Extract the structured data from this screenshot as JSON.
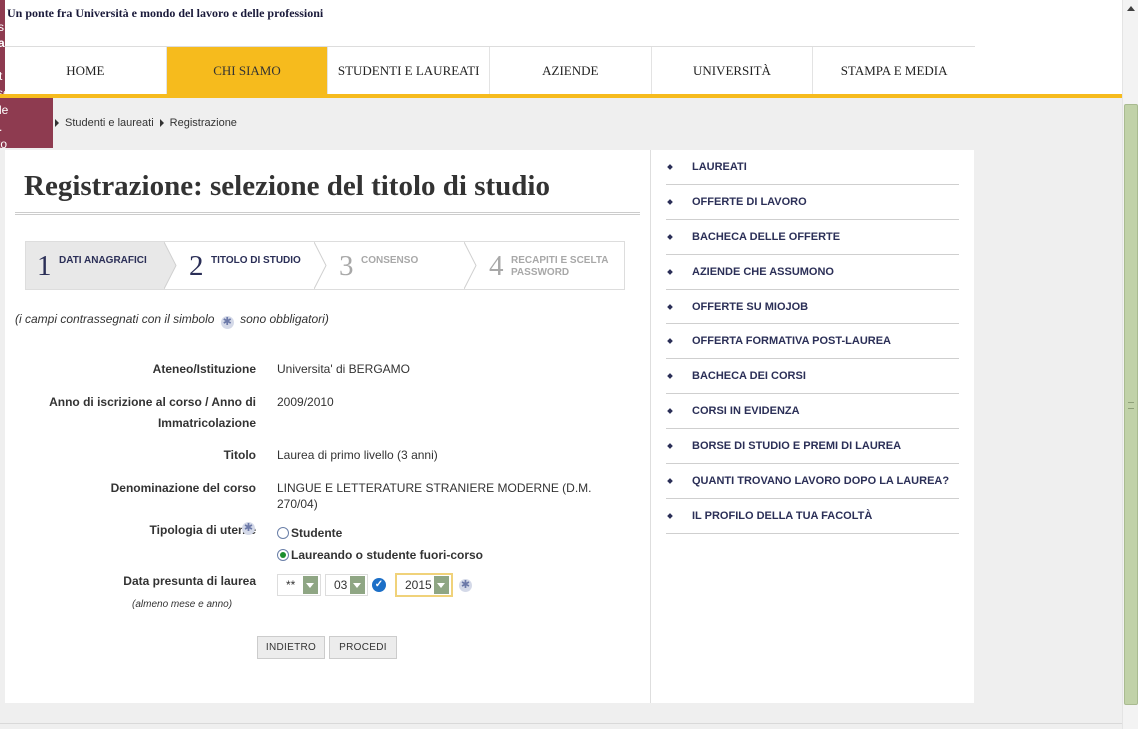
{
  "header": {
    "tagline": "Un ponte fra Università e mondo del lavoro e delle professioni",
    "side_fragments": [
      "s",
      "a",
      "t",
      "sere",
      "le",
      ".",
      "to"
    ]
  },
  "nav": {
    "items": [
      {
        "label": "HOME",
        "active": false
      },
      {
        "label": "CHI SIAMO",
        "active": true
      },
      {
        "label": "STUDENTI E LAUREATI",
        "active": false
      },
      {
        "label": "AZIENDE",
        "active": false
      },
      {
        "label": "UNIVERSITÀ",
        "active": false
      },
      {
        "label": "STAMPA E MEDIA",
        "active": false
      }
    ],
    "accent_color": "#f6bb1d"
  },
  "breadcrumb": [
    "Studenti e laureati",
    "Registrazione"
  ],
  "main": {
    "title": "Registrazione: selezione del titolo di studio",
    "steps": [
      {
        "number": "1",
        "label": "DATI ANAGRAFICI",
        "state": "done"
      },
      {
        "number": "2",
        "label": "TITOLO DI STUDIO",
        "state": "current"
      },
      {
        "number": "3",
        "label": "CONSENSO",
        "state": "todo"
      },
      {
        "number": "4",
        "label": "RECAPITI E SCELTA PASSWORD",
        "state": "todo"
      }
    ],
    "required_note_prefix": "(i campi contrassegnati con il simbolo",
    "required_note_suffix": "sono obbligatori)",
    "form": {
      "ateneo_label": "Ateneo/Istituzione",
      "ateneo_value": "Universita' di BERGAMO",
      "anno_label": "Anno di iscrizione al corso / Anno di Immatricolazione",
      "anno_value": "2009/2010",
      "titolo_label": "Titolo",
      "titolo_value": "Laurea di primo livello (3 anni)",
      "denominazione_label": "Denominazione del corso",
      "denominazione_value": "LINGUE E LETTERATURE STRANIERE MODERNE (D.M. 270/04)",
      "tipologia_label": "Tipologia di utente",
      "tipologia_options": [
        {
          "label": "Studente",
          "checked": false
        },
        {
          "label": "Laureando o studente fuori-corso",
          "checked": true
        }
      ],
      "data_label": "Data presunta di laurea",
      "data_sublabel": "(almeno mese e anno)",
      "day_value": "**",
      "month_value": "03",
      "year_value": "2015"
    },
    "buttons": {
      "back": "INDIETRO",
      "next": "PROCEDI"
    }
  },
  "sidebar": {
    "items": [
      "LAUREATI",
      "OFFERTE DI LAVORO",
      "BACHECA DELLE OFFERTE",
      "AZIENDE CHE ASSUMONO",
      "OFFERTE SU MIOJOB",
      "OFFERTA FORMATIVA POST-LAUREA",
      "BACHECA DEI CORSI",
      "CORSI IN EVIDENZA",
      "BORSE DI STUDIO E PREMI DI LAUREA",
      "QUANTI TROVANO LAVORO DOPO LA LAUREA?",
      "IL PROFILO DELLA TUA FACOLTÀ"
    ]
  },
  "icons": {
    "required": "asterisk-icon",
    "date_valid": "check-icon",
    "dropdown": "chevron-down-icon",
    "bullet": "diamond-bullet-icon"
  }
}
